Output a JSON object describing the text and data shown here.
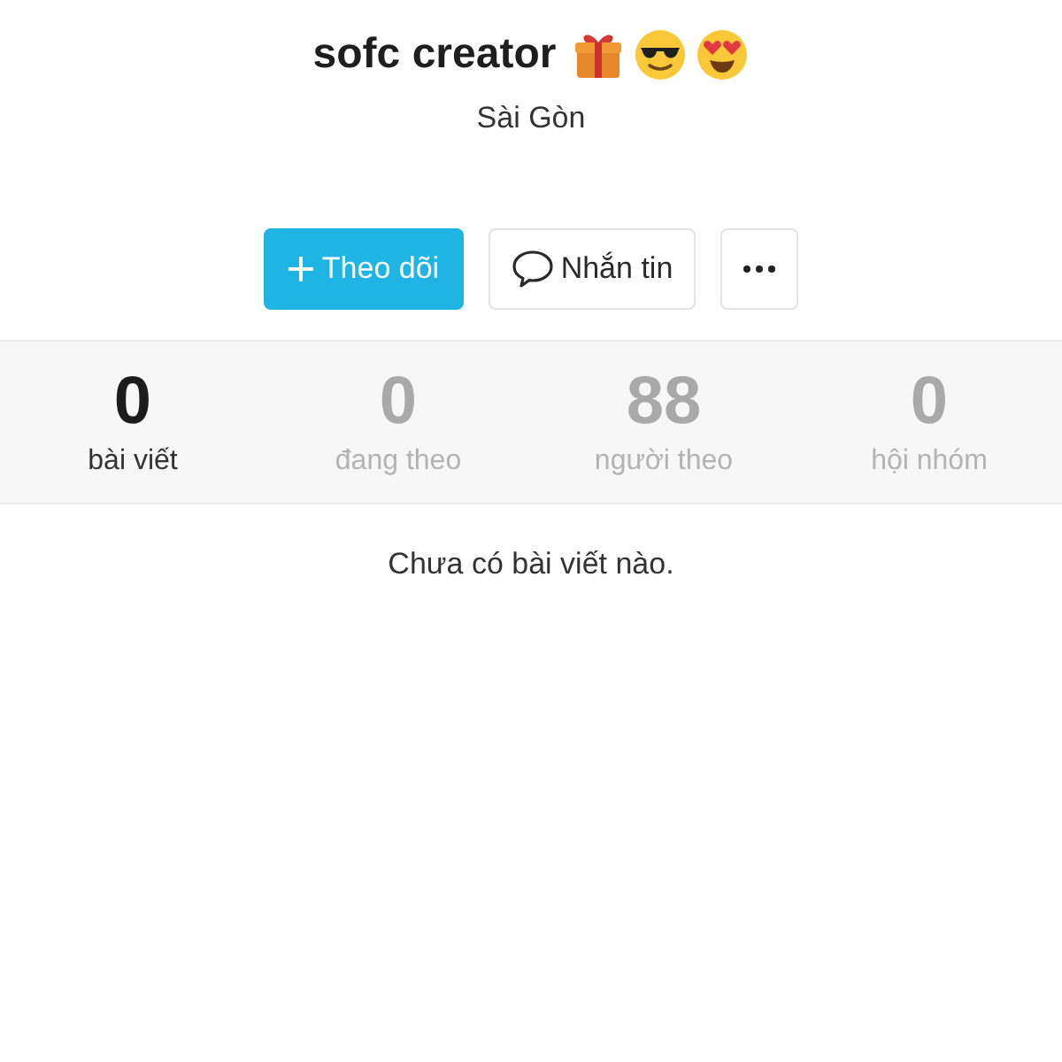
{
  "profile": {
    "name": "sofc creator",
    "location": "Sài Gòn"
  },
  "actions": [
    {
      "kind": "follow",
      "label": "Theo dõi"
    },
    {
      "kind": "message",
      "label": "Nhắn tin"
    },
    {
      "kind": "more"
    }
  ],
  "stats": [
    {
      "value": "0",
      "label": "bài viết",
      "selected": true
    },
    {
      "value": "0",
      "label": "đang theo",
      "selected": false
    },
    {
      "value": "88",
      "label": "người theo",
      "selected": false
    },
    {
      "value": "0",
      "label": "hội nhóm",
      "selected": false
    }
  ],
  "empty_message": "Chưa có bài viết nào."
}
